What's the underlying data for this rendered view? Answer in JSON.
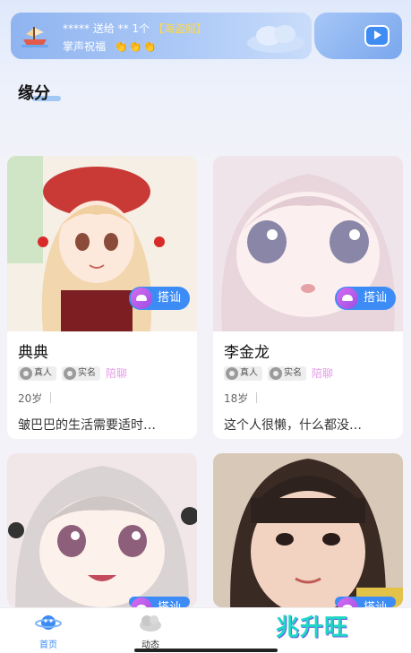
{
  "banner": {
    "sender": "*****",
    "verb": "送给",
    "receiver": "**",
    "count": "1个",
    "gift": "【海盗船】",
    "line2": "掌声祝福",
    "icon": "pirate-ship-icon"
  },
  "section_title": "缘分",
  "cards": [
    {
      "name": "典典",
      "tag_real": "真人",
      "tag_verified": "实名",
      "tag_extra": "陪聊",
      "age": "20岁",
      "bio": "皱巴巴的生活需要适时…",
      "chat_label": "搭讪"
    },
    {
      "name": "李金龙",
      "tag_real": "真人",
      "tag_verified": "实名",
      "tag_extra": "陪聊",
      "age": "18岁",
      "bio": "这个人很懒，什么都没…",
      "chat_label": "搭讪"
    },
    {
      "chat_label": "搭讪"
    },
    {
      "chat_label": "搭讪"
    }
  ],
  "nav": {
    "home": "首页",
    "moments": "动态",
    "brand": "兆升旺"
  },
  "colors": {
    "accent": "#3d8cf5",
    "pink": "#e59be9",
    "brand": "#20d6c4"
  }
}
